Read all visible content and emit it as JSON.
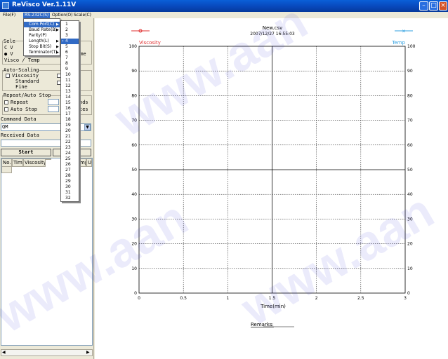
{
  "window": {
    "title": "ReVisco Ver.1.11V"
  },
  "menubar": {
    "items": [
      "File(F)",
      "RS-232C(S)",
      "Option(O)",
      "Scale(C)"
    ]
  },
  "rs232_menu": {
    "items": [
      "Com Port(C)",
      "Baud Rate(B)",
      "Parity(P)",
      "Length(L)",
      "Stop Bit(S)",
      "Terminator(T)"
    ],
    "com_ports": [
      "1",
      "2",
      "3",
      "4",
      "5",
      "6",
      "7",
      "8",
      "9",
      "10",
      "11",
      "12",
      "13",
      "14",
      "15",
      "16",
      "17",
      "18",
      "19",
      "20",
      "21",
      "22",
      "23",
      "24",
      "25",
      "26",
      "27",
      "28",
      "29",
      "30",
      "31",
      "32"
    ],
    "selected_port": "4"
  },
  "left_panel": {
    "select_group": {
      "label": "Sele",
      "opt1": "C V",
      "opt2": "● V",
      "opt3": "Visco / Temp",
      "right_text": "ime"
    },
    "auto_scaling": {
      "label": "Auto-Scaling",
      "viscosity": "Viscosity",
      "standard": "Standard",
      "fine": "Fine"
    },
    "repeat_group": {
      "label": "Repeat/Auto Stop",
      "repeat": "Repeat",
      "auto_stop": "Auto Stop",
      "unit1": "nds",
      "unit2": "tes"
    },
    "command_data": {
      "label": "Command Data",
      "value": "QM"
    },
    "received_data": {
      "label": "Received Data",
      "value": ""
    },
    "start_button": "Start",
    "table_headers": [
      "No.",
      "Time",
      "Viscosity",
      "",
      "mp",
      "U"
    ]
  },
  "chart": {
    "file_title": "New.csv",
    "datetime": "2007/12/27 16:55:03",
    "left_legend": "Viscosity",
    "right_legend": "Temp",
    "remarks_label": "Remarks:",
    "colors": {
      "viscosity": "#e03030",
      "temp": "#30a0e0",
      "center_line": "#000000"
    }
  },
  "chart_data": {
    "type": "line",
    "title": "New.csv",
    "subtitle": "2007/12/27 16:55:03",
    "xlabel": "Time(min)",
    "ylabel": "Viscosity",
    "y2label": "Temp",
    "xlim": [
      0,
      3
    ],
    "ylim": [
      0,
      100
    ],
    "y2lim": [
      0,
      100
    ],
    "x_ticks": [
      "0",
      "0.5",
      "1",
      "1.5",
      "2",
      "2.5",
      "3"
    ],
    "y_ticks": [
      "0",
      "10",
      "20",
      "30",
      "40",
      "50",
      "60",
      "70",
      "80",
      "90",
      "100"
    ],
    "series": [
      {
        "name": "Viscosity",
        "values": []
      },
      {
        "name": "Temp",
        "values": []
      }
    ],
    "grid": true
  },
  "watermark": {
    "text": "www.aan"
  }
}
